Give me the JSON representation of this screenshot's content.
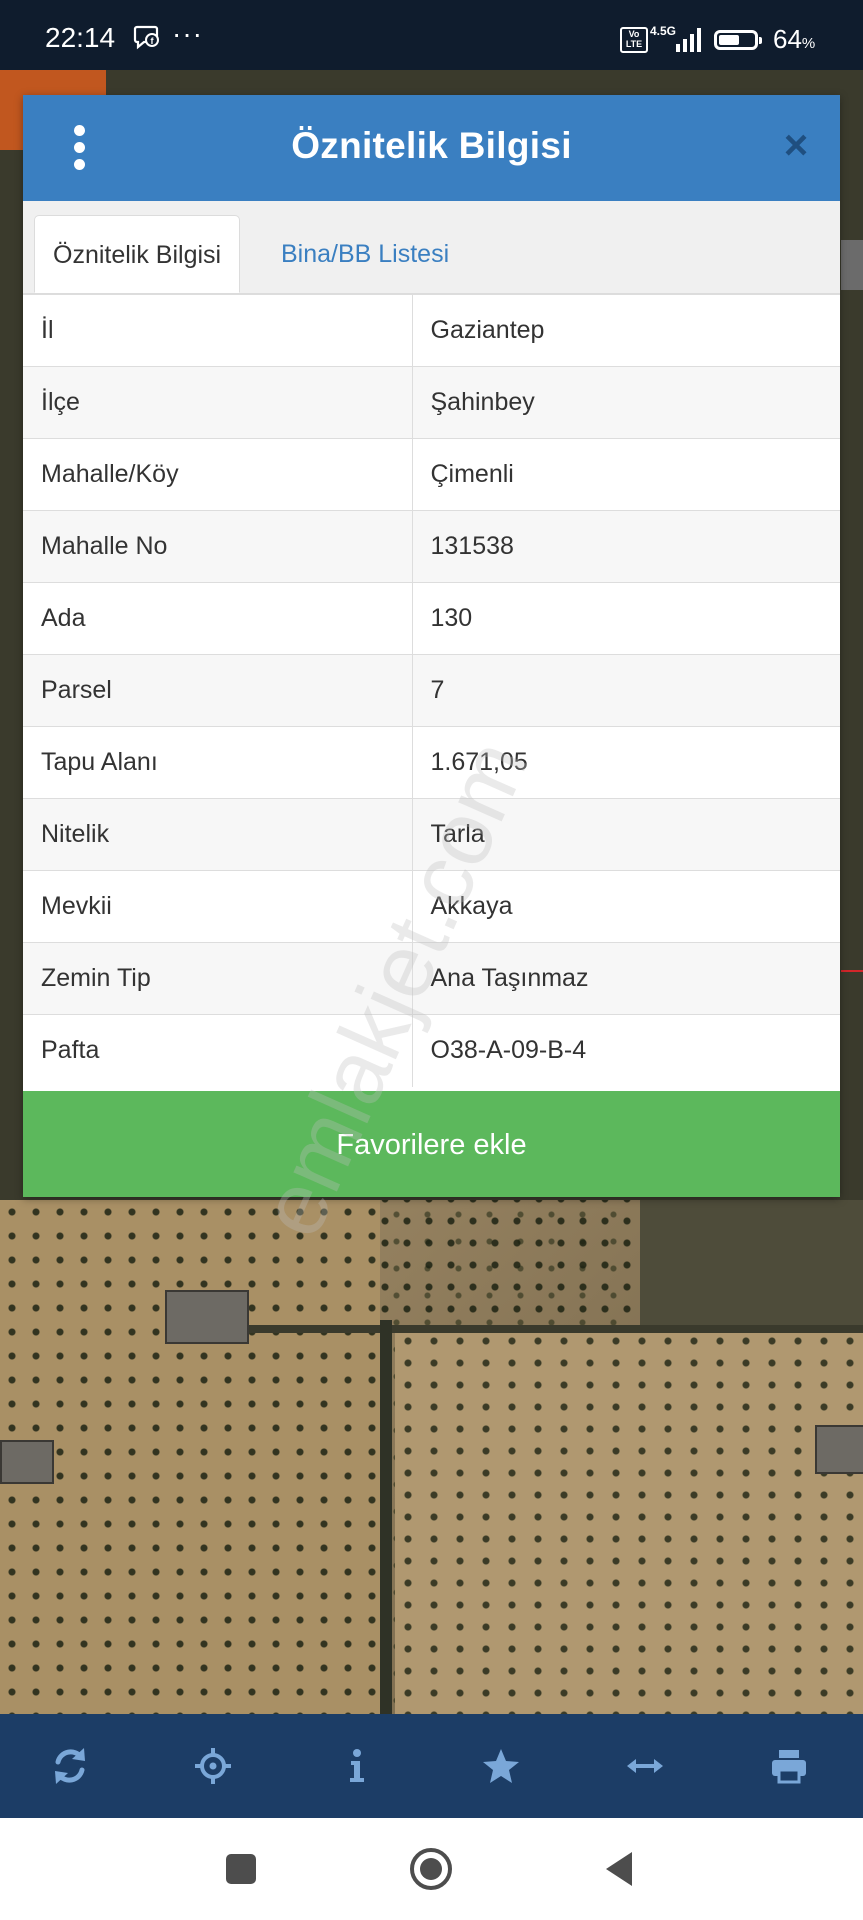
{
  "status_bar": {
    "time": "22:14",
    "dots": "···",
    "volte_label": "Vo LTE",
    "network_label": "4.5G",
    "battery_percent": 64,
    "battery_text": "64",
    "battery_unit": "%"
  },
  "dialog": {
    "title": "Öznitelik Bilgisi",
    "close_symbol": "×",
    "tabs": [
      {
        "label": "Öznitelik Bilgisi",
        "active": true
      },
      {
        "label": "Bina/BB Listesi",
        "active": false
      }
    ],
    "rows": [
      {
        "key": "İl",
        "value": "Gaziantep"
      },
      {
        "key": "İlçe",
        "value": "Şahinbey"
      },
      {
        "key": "Mahalle/Köy",
        "value": "Çimenli"
      },
      {
        "key": "Mahalle No",
        "value": "131538"
      },
      {
        "key": "Ada",
        "value": "130"
      },
      {
        "key": "Parsel",
        "value": "7"
      },
      {
        "key": "Tapu Alanı",
        "value": "1.671,05"
      },
      {
        "key": "Nitelik",
        "value": "Tarla"
      },
      {
        "key": "Mevkii",
        "value": "Akkaya"
      },
      {
        "key": "Zemin Tip",
        "value": "Ana Taşınmaz"
      },
      {
        "key": "Pafta",
        "value": "O38-A-09-B-4"
      }
    ],
    "favorite_button": "Favorilere ekle"
  },
  "watermark": "emlakjet.com",
  "toolbar": {
    "items": [
      "refresh-icon",
      "locate-icon",
      "info-icon",
      "star-icon",
      "measure-icon",
      "print-icon"
    ]
  },
  "nav_bar": {
    "items": [
      "recent-apps-icon",
      "home-icon",
      "back-icon"
    ]
  },
  "colors": {
    "header": "#3a7fc1",
    "button": "#5cb85c",
    "toolbar": "#1c3d66",
    "status_bar": "#0f1c2d"
  }
}
